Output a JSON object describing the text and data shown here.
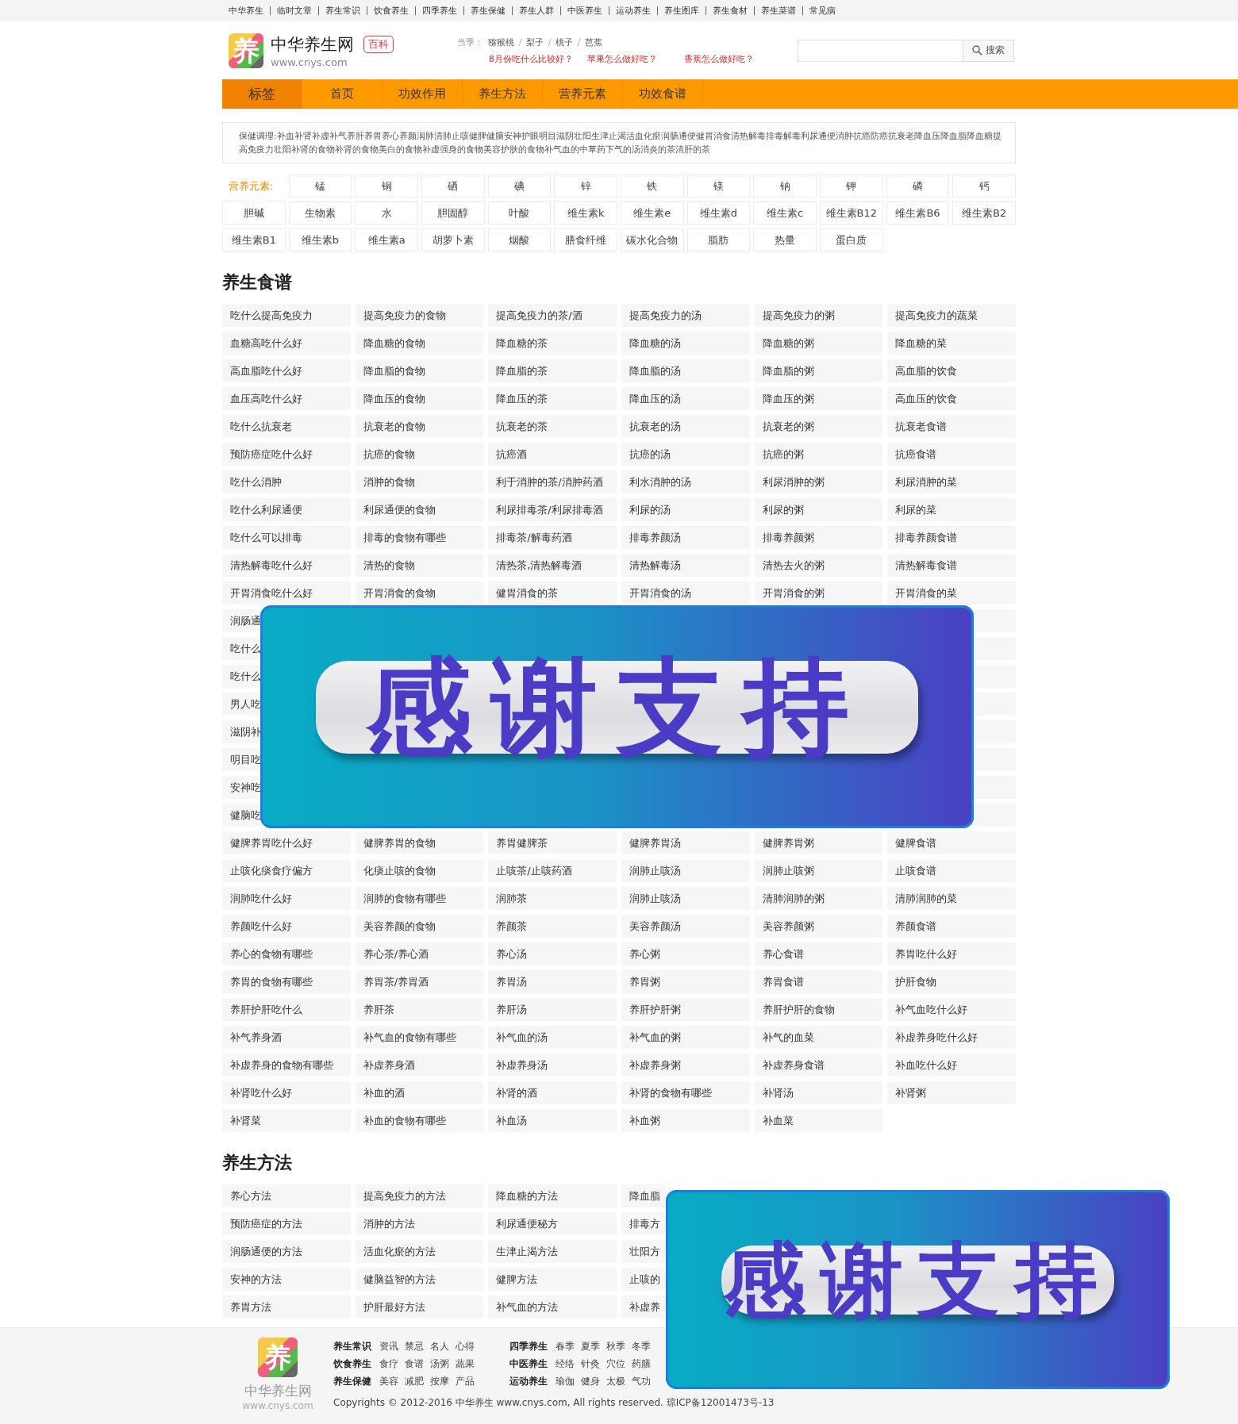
{
  "top_links": [
    "中华养生",
    "临时文章",
    "养生常识",
    "饮食养生",
    "四季养生",
    "养生保健",
    "养生人群",
    "中医养生",
    "运动养生",
    "养生图库",
    "养生食材",
    "养生菜谱",
    "常见病"
  ],
  "header": {
    "logo_mark": "养",
    "site_name": "中华养生网",
    "badge": "百科",
    "url": "www.cnys.com",
    "season_label": "当季：",
    "fruits": [
      "猕猴桃",
      "梨子",
      "桃子",
      "芭蕉"
    ],
    "questions": [
      "8月份吃什么比较好？",
      "苹果怎么做好吃？",
      "香蕉怎么做好吃？"
    ],
    "search_button": "搜索"
  },
  "nav": [
    {
      "label": "标签",
      "selected": true
    },
    {
      "label": "首页",
      "selected": false
    },
    {
      "label": "功效作用",
      "selected": false
    },
    {
      "label": "养生方法",
      "selected": false
    },
    {
      "label": "营养元素",
      "selected": false
    },
    {
      "label": "功效食谱",
      "selected": false
    }
  ],
  "tags_text": "保健调理:补血补肾补虚补气养肝养胃养心养颜润肺清肺止咳健脾健脑安神护眼明目滋阴壮阳生津止渴活血化瘀润肠通便健胃消食清热解毒排毒解毒利尿通便消肿抗癌防癌抗衰老降血压降血脂降血糖提高免疫力壮阳补肾的食物补肾的食物美白的食物补虚强身的食物美容护肤的食物补气血的中草药下气的汤消炎的茶清肝的茶",
  "nutrients": {
    "label": "营养元素:",
    "items": [
      "锰",
      "铜",
      "硒",
      "碘",
      "锌",
      "铁",
      "镁",
      "钠",
      "钾",
      "磷",
      "钙",
      "胆碱",
      "生物素",
      "水",
      "胆固醇",
      "叶酸",
      "维生素k",
      "维生素e",
      "维生素d",
      "维生素c",
      "维生素B12",
      "维生素B6",
      "维生素B2",
      "维生素B1",
      "维生素b",
      "维生素a",
      "胡萝卜素",
      "烟酸",
      "膳食纤维",
      "碳水化合物",
      "脂肪",
      "热量",
      "蛋白质"
    ]
  },
  "recipes": {
    "title": "养生食谱",
    "rows": [
      [
        "吃什么提高免疫力",
        "提高免疫力的食物",
        "提高免疫力的茶/酒",
        "提高免疫力的汤",
        "提高免疫力的粥",
        "提高免疫力的蔬菜"
      ],
      [
        "血糖高吃什么好",
        "降血糖的食物",
        "降血糖的茶",
        "降血糖的汤",
        "降血糖的粥",
        "降血糖的菜"
      ],
      [
        "高血脂吃什么好",
        "降血脂的食物",
        "降血脂的茶",
        "降血脂的汤",
        "降血脂的粥",
        "高血脂的饮食"
      ],
      [
        "血压高吃什么好",
        "降血压的食物",
        "降血压的茶",
        "降血压的汤",
        "降血压的粥",
        "高血压的饮食"
      ],
      [
        "吃什么抗衰老",
        "抗衰老的食物",
        "抗衰老的茶",
        "抗衰老的汤",
        "抗衰老的粥",
        "抗衰老食谱"
      ],
      [
        "预防癌症吃什么好",
        "抗癌的食物",
        "抗癌酒",
        "抗癌的汤",
        "抗癌的粥",
        "抗癌食谱"
      ],
      [
        "吃什么消肿",
        "消肿的食物",
        "利于消肿的茶/消肿药酒",
        "利水消肿的汤",
        "利尿消肿的粥",
        "利尿消肿的菜"
      ],
      [
        "吃什么利尿通便",
        "利尿通便的食物",
        "利尿排毒茶/利尿排毒酒",
        "利尿的汤",
        "利尿的粥",
        "利尿的菜"
      ],
      [
        "吃什么可以排毒",
        "排毒的食物有哪些",
        "排毒茶/解毒药酒",
        "排毒养颜汤",
        "排毒养颜粥",
        "排毒养颜食谱"
      ],
      [
        "清热解毒吃什么好",
        "清热的食物",
        "清热茶,清热解毒酒",
        "清热解毒汤",
        "清热去火的粥",
        "清热解毒食谱"
      ],
      [
        "开胃消食吃什么好",
        "开胃消食的食物",
        "健胃消食的茶",
        "开胃消食的汤",
        "开胃消食的粥",
        "开胃消食的菜"
      ],
      [
        "润肠通"
      ],
      [
        "吃什么"
      ],
      [
        "吃什么"
      ],
      [
        "男人吃"
      ],
      [
        "滋阴补"
      ],
      [
        "明目吃"
      ],
      [
        "安神吃"
      ],
      [
        "健脑吃"
      ],
      [
        "健脾养胃吃什么好",
        "健脾养胃的食物",
        "养胃健脾茶",
        "健脾养胃汤",
        "健脾养胃粥",
        "健脾食谱"
      ],
      [
        "止咳化痰食疗偏方",
        "化痰止咳的食物",
        "止咳茶/止咳药酒",
        "润肺止咳汤",
        "润肺止咳粥",
        "止咳食谱"
      ],
      [
        "润肺吃什么好",
        "润肺的食物有哪些",
        "润肺茶",
        "润肺止咳汤",
        "清肺润肺的粥",
        "清肺润肺的菜"
      ],
      [
        "养颜吃什么好",
        "美容养颜的食物",
        "养颜茶",
        "美容养颜汤",
        "美容养颜粥",
        "养颜食谱"
      ],
      [
        "养心的食物有哪些",
        "养心茶/养心酒",
        "养心汤",
        "养心粥",
        "养心食谱",
        "养胃吃什么好"
      ],
      [
        "养胃的食物有哪些",
        "养胃茶/养胃酒",
        "养胃汤",
        "养胃粥",
        "养胃食谱",
        "护肝食物"
      ],
      [
        "养肝护肝吃什么",
        "养肝茶",
        "养肝汤",
        "养肝护肝粥",
        "养肝护肝的食物",
        "补气血吃什么好"
      ],
      [
        "补气养身酒",
        "补气血的食物有哪些",
        "补气血的汤",
        "补气血的粥",
        "补气的血菜",
        "补虚养身吃什么好"
      ],
      [
        "补虚养身的食物有哪些",
        "补虚养身酒",
        "补虚养身汤",
        "补虚养身粥",
        "补虚养身食谱",
        "补血吃什么好"
      ],
      [
        "补肾吃什么好",
        "补血的酒",
        "补肾的酒",
        "补肾的食物有哪些",
        "补肾汤",
        "补肾粥"
      ],
      [
        "补肾菜",
        "补血的食物有哪些",
        "补血汤",
        "补血粥",
        "补血菜"
      ]
    ]
  },
  "methods": {
    "title": "养生方法",
    "rows": [
      [
        "养心方法",
        "提高免疫力的方法",
        "降血糖的方法",
        "降血脂"
      ],
      [
        "预防癌症的方法",
        "消肿的方法",
        "利尿通便秘方",
        "排毒方"
      ],
      [
        "润肠通便的方法",
        "活血化瘀的方法",
        "生津止渴方法",
        "壮阳方"
      ],
      [
        "安神的方法",
        "健脑益智的方法",
        "健脾方法",
        "止咳的"
      ],
      [
        "养胃方法",
        "护肝最好方法",
        "补气血的方法",
        "补虚养"
      ]
    ]
  },
  "footer": {
    "logo_mark": "养",
    "site_name": "中华养生网",
    "url": "www.cnys.com",
    "groups": [
      {
        "title": "养生常识",
        "links": [
          "资讯",
          "禁忌",
          "名人",
          "心得"
        ]
      },
      {
        "title": "饮食养生",
        "links": [
          "食疗",
          "食谱",
          "汤粥",
          "蔬果"
        ]
      },
      {
        "title": "养生保健",
        "links": [
          "美容",
          "减肥",
          "按摩",
          "产品"
        ]
      },
      {
        "title": "四季养生",
        "links": [
          "春季",
          "夏季",
          "秋季",
          "冬季"
        ]
      },
      {
        "title": "中医养生",
        "links": [
          "经络",
          "针灸",
          "穴位",
          "药膳"
        ]
      },
      {
        "title": "运动养生",
        "links": [
          "瑜伽",
          "健身",
          "太极",
          "气功"
        ]
      }
    ],
    "copyright": "Copyrights © 2012-2016 中华养生 www.cnys.com, All rights reserved. 琼ICP备12001473号-13"
  },
  "overlays": [
    {
      "text": "感谢支持"
    },
    {
      "text": "感谢支持"
    }
  ]
}
